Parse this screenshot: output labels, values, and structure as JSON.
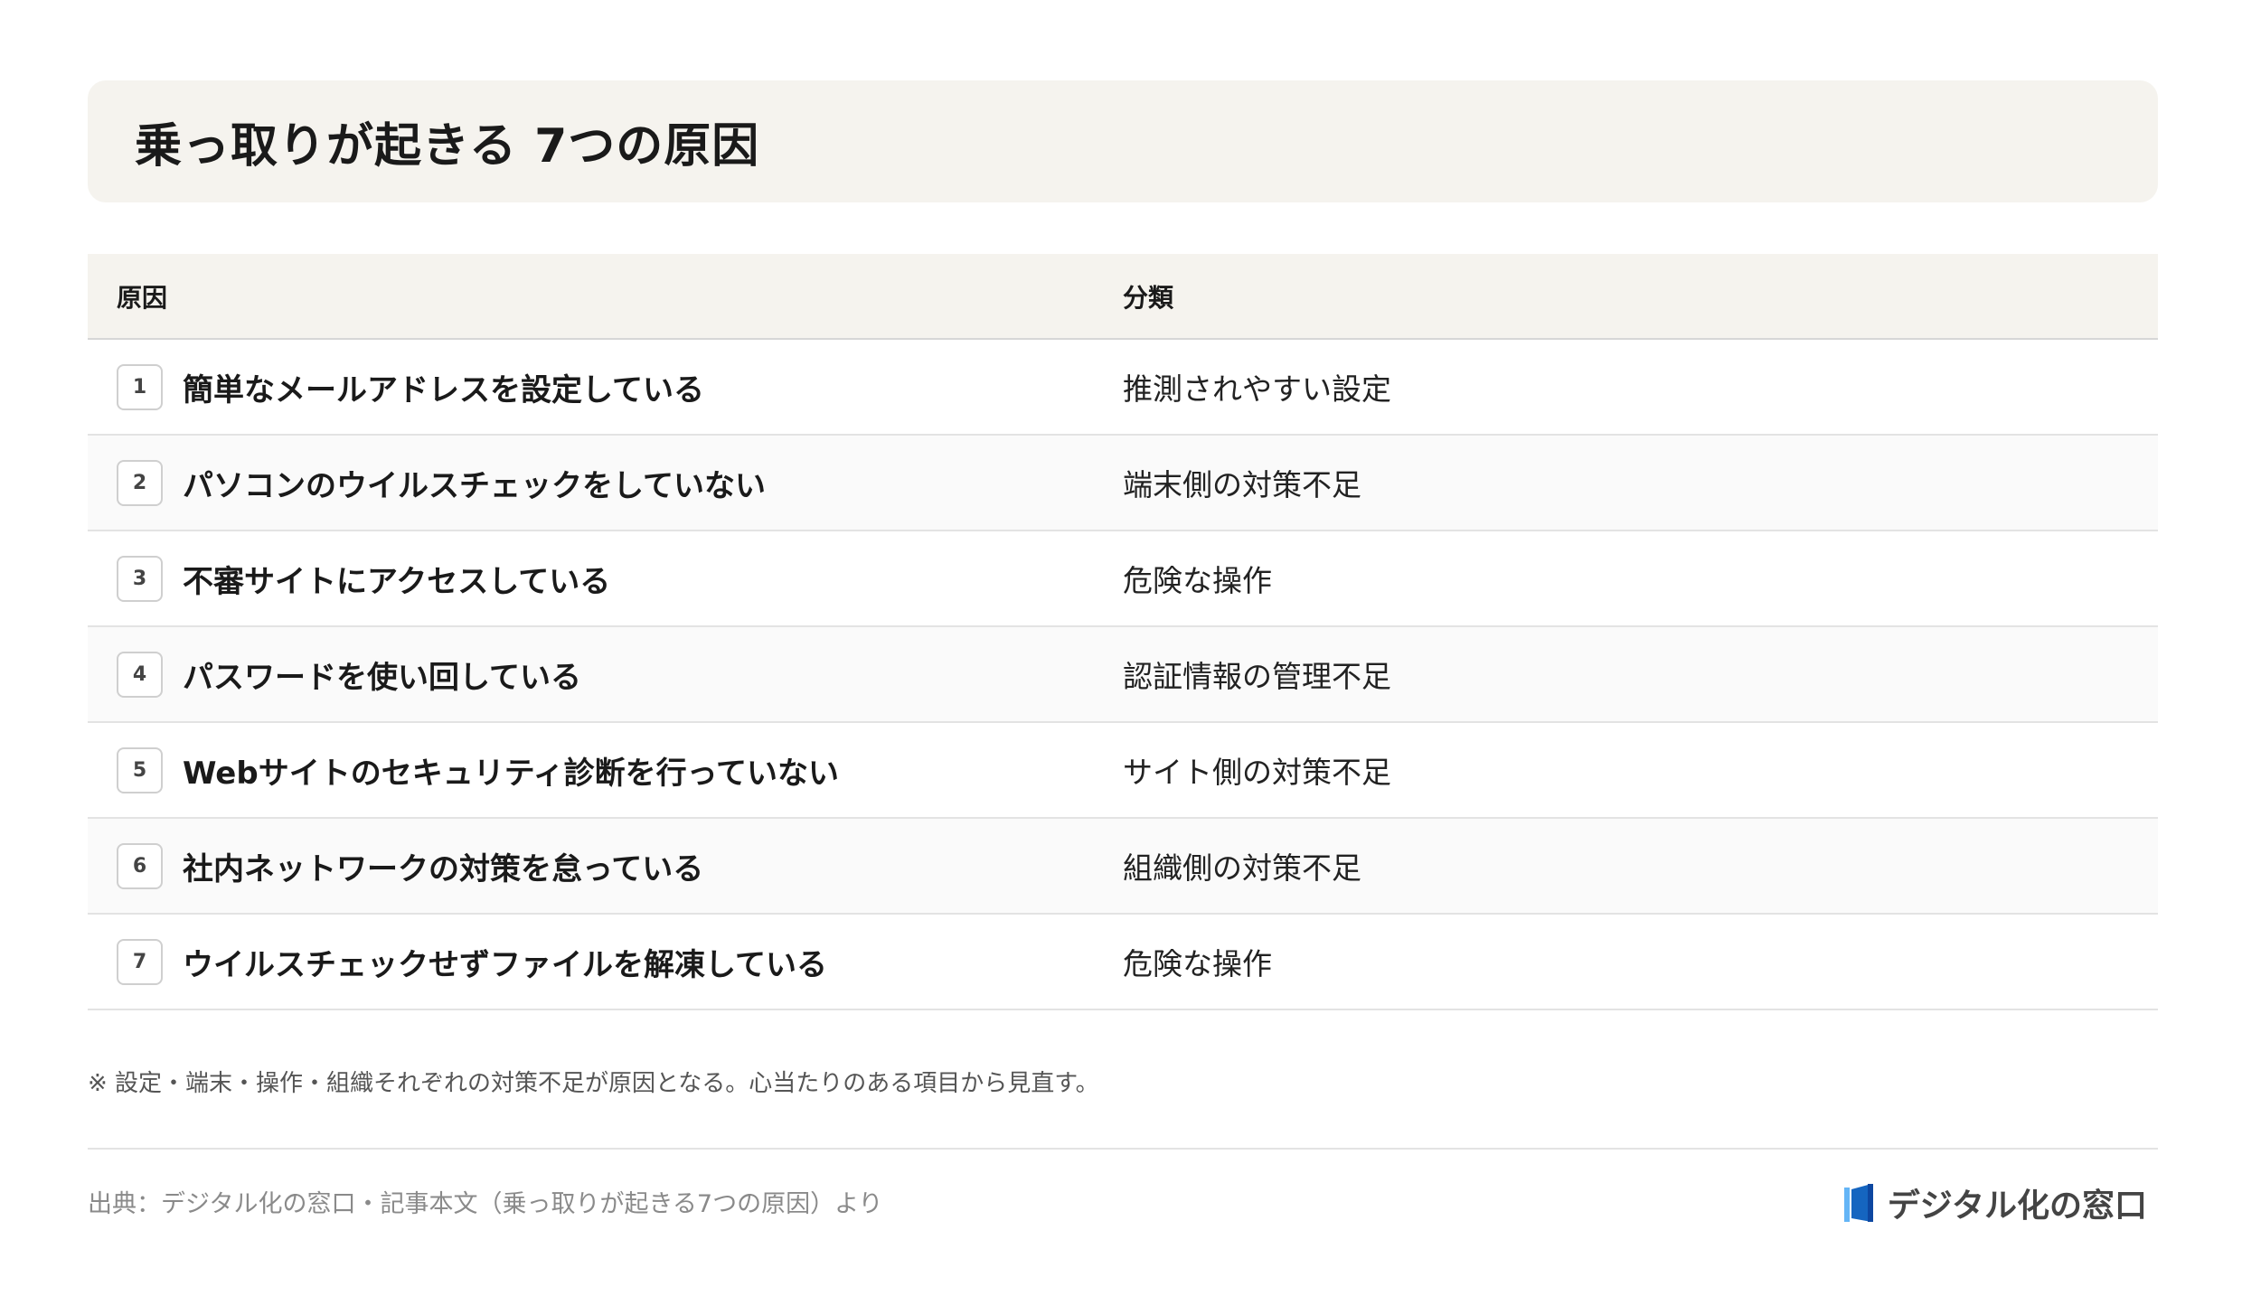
{
  "title": "乗っ取りが起きる 7つの原因",
  "table": {
    "headers": [
      "原因",
      "分類"
    ],
    "rows": [
      {
        "num": "1",
        "cause": "簡単なメールアドレスを設定している",
        "category": "推測されやすい設定"
      },
      {
        "num": "2",
        "cause": "パソコンのウイルスチェックをしていない",
        "category": "端末側の対策不足"
      },
      {
        "num": "3",
        "cause": "不審サイトにアクセスしている",
        "category": "危険な操作"
      },
      {
        "num": "4",
        "cause": "パスワードを使い回している",
        "category": "認証情報の管理不足"
      },
      {
        "num": "5",
        "cause": "Webサイトのセキュリティ診断を行っていない",
        "category": "サイト側の対策不足"
      },
      {
        "num": "6",
        "cause": "社内ネットワークの対策を怠っている",
        "category": "組織側の対策不足"
      },
      {
        "num": "7",
        "cause": "ウイルスチェックせずファイルを解凍している",
        "category": "危険な操作"
      }
    ]
  },
  "note": "※ 設定・端末・操作・組織それぞれの対策不足が原因となる。心当たりのある項目から見直す。",
  "source": "出典：デジタル化の窓口・記事本文（乗っ取りが起きる7つの原因）より",
  "brand": {
    "name": "デジタル化の窓口",
    "color": "#1565c0"
  }
}
